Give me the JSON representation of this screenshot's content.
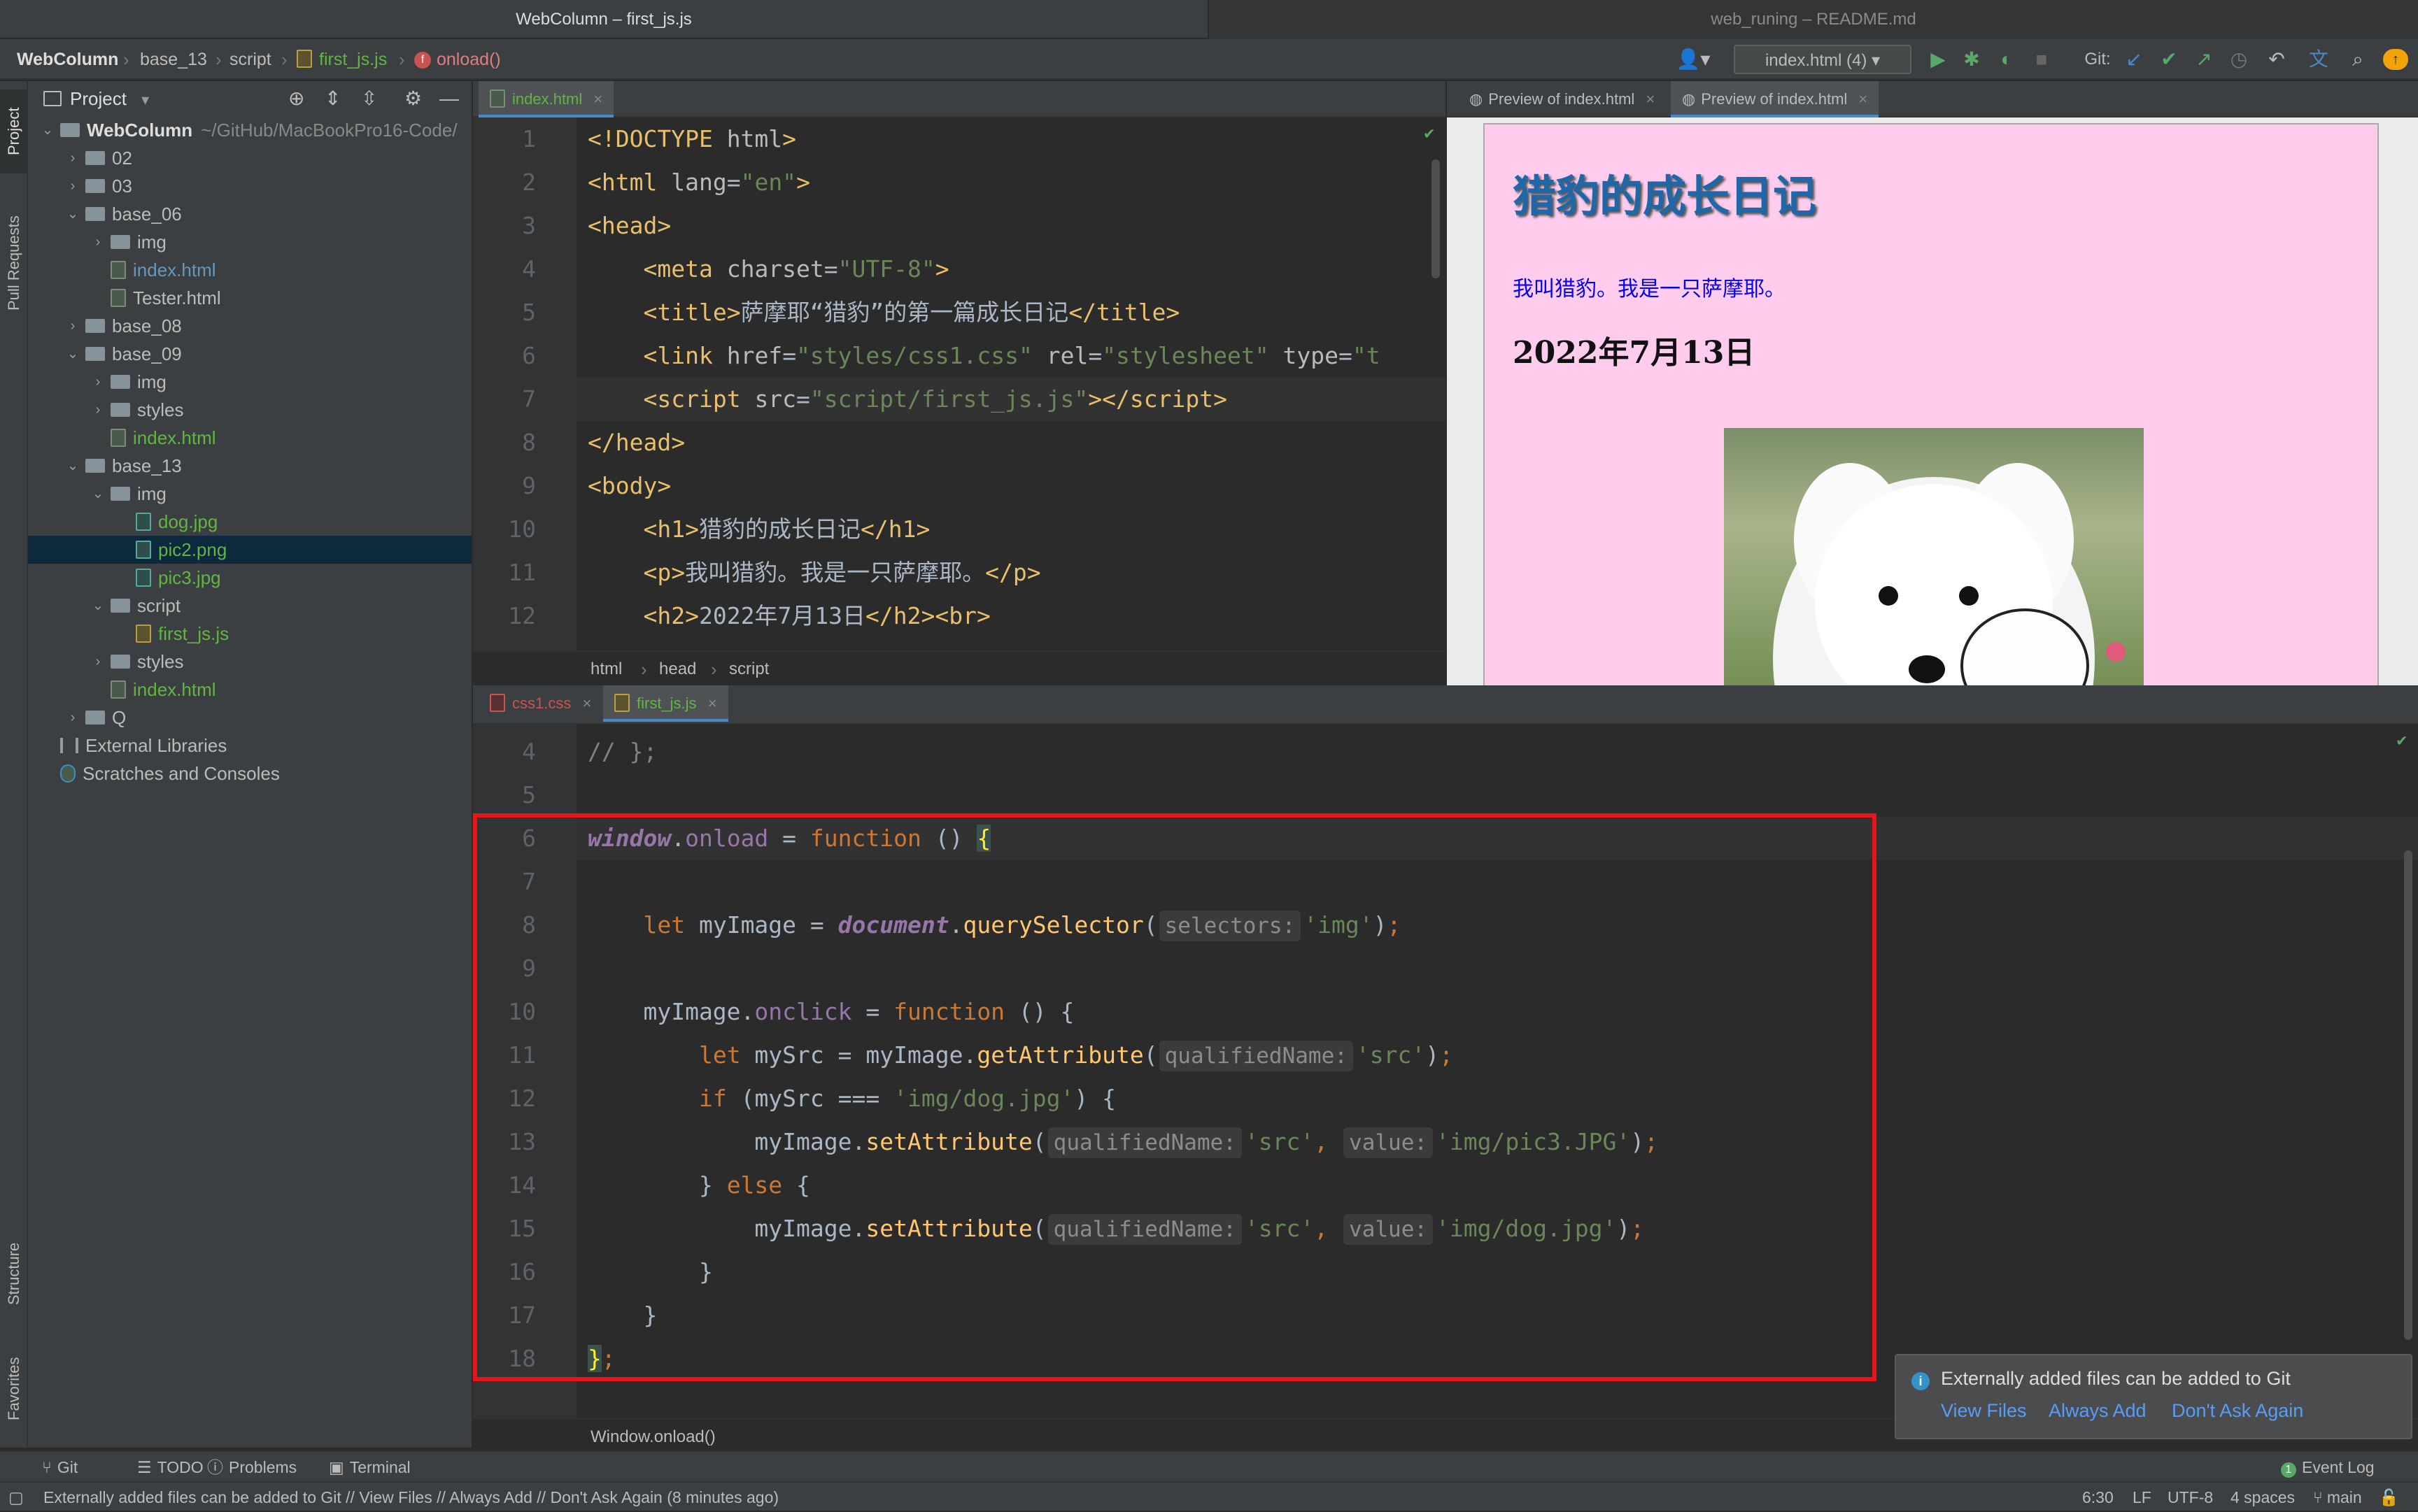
{
  "window": {
    "left_title": "WebColumn – first_js.js",
    "right_title": "web_runing – README.md"
  },
  "navbar": {
    "crumbs": [
      "WebColumn",
      "base_13",
      "script",
      "first_js.js",
      "onload()"
    ],
    "run_config": "index.html (4)",
    "git_label": "Git:"
  },
  "left_strip": {
    "project": "Project",
    "pull_requests": "Pull Requests",
    "structure": "Structure",
    "favorites": "Favorites"
  },
  "project": {
    "header": "Project",
    "tree": [
      {
        "label": "WebColumn",
        "suffix": "~/GitHub/MacBookPro16-Code/",
        "kind": "root",
        "indent": 0,
        "arrow": "open",
        "color": "#dddddd"
      },
      {
        "label": "02",
        "kind": "folder",
        "indent": 1,
        "arrow": "closed",
        "color": "#bbbbbb"
      },
      {
        "label": "03",
        "kind": "folder",
        "indent": 1,
        "arrow": "closed",
        "color": "#bbbbbb"
      },
      {
        "label": "base_06",
        "kind": "folder",
        "indent": 1,
        "arrow": "open",
        "color": "#bbbbbb"
      },
      {
        "label": "img",
        "kind": "folder",
        "indent": 2,
        "arrow": "closed",
        "color": "#bbbbbb"
      },
      {
        "label": "index.html",
        "kind": "html",
        "indent": 2,
        "arrow": "",
        "color": "#6897bb"
      },
      {
        "label": "Tester.html",
        "kind": "html",
        "indent": 2,
        "arrow": "",
        "color": "#bbbbbb"
      },
      {
        "label": "base_08",
        "kind": "folder",
        "indent": 1,
        "arrow": "closed",
        "color": "#bbbbbb"
      },
      {
        "label": "base_09",
        "kind": "folder",
        "indent": 1,
        "arrow": "open",
        "color": "#bbbbbb"
      },
      {
        "label": "img",
        "kind": "folder",
        "indent": 2,
        "arrow": "closed",
        "color": "#bbbbbb"
      },
      {
        "label": "styles",
        "kind": "folder",
        "indent": 2,
        "arrow": "closed",
        "color": "#bbbbbb"
      },
      {
        "label": "index.html",
        "kind": "html",
        "indent": 2,
        "arrow": "",
        "color": "#62b543"
      },
      {
        "label": "base_13",
        "kind": "folder",
        "indent": 1,
        "arrow": "open",
        "color": "#bbbbbb"
      },
      {
        "label": "img",
        "kind": "folder",
        "indent": 2,
        "arrow": "open",
        "color": "#bbbbbb"
      },
      {
        "label": "dog.jpg",
        "kind": "img",
        "indent": 3,
        "arrow": "",
        "color": "#62b543"
      },
      {
        "label": "pic2.png",
        "kind": "img",
        "indent": 3,
        "arrow": "",
        "color": "#62b543",
        "selected": true
      },
      {
        "label": "pic3.jpg",
        "kind": "img",
        "indent": 3,
        "arrow": "",
        "color": "#62b543"
      },
      {
        "label": "script",
        "kind": "folder",
        "indent": 2,
        "arrow": "open",
        "color": "#bbbbbb"
      },
      {
        "label": "first_js.js",
        "kind": "js",
        "indent": 3,
        "arrow": "",
        "color": "#62b543"
      },
      {
        "label": "styles",
        "kind": "folder",
        "indent": 2,
        "arrow": "closed",
        "color": "#bbbbbb"
      },
      {
        "label": "index.html",
        "kind": "html",
        "indent": 2,
        "arrow": "",
        "color": "#62b543"
      },
      {
        "label": "Q",
        "kind": "folder",
        "indent": 1,
        "arrow": "closed",
        "color": "#bbbbbb"
      },
      {
        "label": "External Libraries",
        "kind": "lib",
        "indent": 0,
        "arrow": "",
        "color": "#bbbbbb"
      },
      {
        "label": "Scratches and Consoles",
        "kind": "scratch",
        "indent": 0,
        "arrow": "",
        "color": "#bbbbbb"
      }
    ]
  },
  "editor_top": {
    "tab": "index.html",
    "lines": [
      {
        "n": "1",
        "html": "<span class=\"tag\">&lt;!DOCTYPE </span><span class=\"attr\">html</span><span class=\"tag\">&gt;</span>"
      },
      {
        "n": "2",
        "html": "<span class=\"tag\">&lt;html </span><span class=\"attr\">lang</span>=<span class=\"str\">\"en\"</span><span class=\"tag\">&gt;</span>"
      },
      {
        "n": "3",
        "html": "<span class=\"tag\">&lt;head&gt;</span>"
      },
      {
        "n": "4",
        "html": "    <span class=\"tag\">&lt;meta </span><span class=\"attr\">charset</span>=<span class=\"str\">\"UTF-8\"</span><span class=\"tag\">&gt;</span>"
      },
      {
        "n": "5",
        "html": "    <span class=\"tag\">&lt;title&gt;</span>萨摩耶“猎豹”的第一篇成长日记<span class=\"tag\">&lt;/title&gt;</span>"
      },
      {
        "n": "6",
        "html": "    <span class=\"tag\">&lt;link </span><span class=\"attr\">href</span>=<span class=\"str\">\"styles/css1.css\"</span> <span class=\"attr\">rel</span>=<span class=\"str\">\"stylesheet\"</span> <span class=\"attr\">type</span>=<span class=\"str\">\"t</span>"
      },
      {
        "n": "7",
        "html": "    <span class=\"tag\">&lt;script </span><span class=\"attr\">src</span>=<span class=\"str\">\"script/first_js.js\"</span><span class=\"tag\">&gt;&lt;/script&gt;</span>"
      },
      {
        "n": "8",
        "html": "<span class=\"tag\">&lt;/head&gt;</span>"
      },
      {
        "n": "9",
        "html": "<span class=\"tag\">&lt;body&gt;</span>"
      },
      {
        "n": "10",
        "html": "    <span class=\"tag\">&lt;h1&gt;</span>猎豹的成长日记<span class=\"tag\">&lt;/h1&gt;</span>"
      },
      {
        "n": "11",
        "html": "    <span class=\"tag\">&lt;p&gt;</span>我叫猎豹。我是一只萨摩耶。<span class=\"tag\">&lt;/p&gt;</span>"
      },
      {
        "n": "12",
        "html": "    <span class=\"tag\">&lt;h2&gt;</span>2022年7月13日<span class=\"tag\">&lt;/h2&gt;&lt;br&gt;</span>"
      }
    ],
    "breadcrumb": [
      "html",
      "head",
      "script"
    ]
  },
  "preview": {
    "tabs": [
      "Preview of index.html",
      "Preview of index.html"
    ],
    "h1": "猎豹的成长日记",
    "p": "我叫猎豹。我是一只萨摩耶。",
    "h2": "2022年7月13日"
  },
  "editor_bottom": {
    "tabs": [
      "css1.css",
      "first_js.js"
    ],
    "lines": [
      {
        "n": "4",
        "html": "<span class=\"cmt\">// };</span>"
      },
      {
        "n": "5",
        "html": ""
      },
      {
        "n": "6",
        "html": "<span class=\"glob\">window</span>.<span class=\"prop\">onload</span> = <span class=\"kw\">function</span> () <span style=\"color:#ffef28;background:#3b514d\">{</span>"
      },
      {
        "n": "7",
        "html": ""
      },
      {
        "n": "8",
        "html": "    <span class=\"kw\">let</span> myImage = <span class=\"glob\">document</span>.<span class=\"fn\">querySelector</span>(<span class=\"hint\">selectors:</span><span class=\"str\">'img'</span>)<span class=\"kw\">;</span>"
      },
      {
        "n": "9",
        "html": ""
      },
      {
        "n": "10",
        "html": "    myImage.<span class=\"prop\">onclick</span> = <span class=\"kw\">function</span> () {"
      },
      {
        "n": "11",
        "html": "        <span class=\"kw\">let</span> mySrc = myImage.<span class=\"fn\">getAttribute</span>(<span class=\"hint\">qualifiedName:</span><span class=\"str\">'src'</span>)<span class=\"kw\">;</span>"
      },
      {
        "n": "12",
        "html": "        <span class=\"kw\">if</span> (mySrc === <span class=\"str\">'img/dog.jpg'</span>) {"
      },
      {
        "n": "13",
        "html": "            myImage.<span class=\"fn\">setAttribute</span>(<span class=\"hint\">qualifiedName:</span><span class=\"str\">'src'</span><span class=\"kw\">,</span> <span class=\"hint\">value:</span><span class=\"str\">'img/pic3.JPG'</span>)<span class=\"kw\">;</span>"
      },
      {
        "n": "14",
        "html": "        } <span class=\"kw\">else</span> {"
      },
      {
        "n": "15",
        "html": "            myImage.<span class=\"fn\">setAttribute</span>(<span class=\"hint\">qualifiedName:</span><span class=\"str\">'src'</span><span class=\"kw\">,</span> <span class=\"hint\">value:</span><span class=\"str\">'img/dog.jpg'</span>)<span class=\"kw\">;</span>"
      },
      {
        "n": "16",
        "html": "        }"
      },
      {
        "n": "17",
        "html": "    }"
      },
      {
        "n": "18",
        "html": "<span style=\"color:#ffef28;background:#3b514d\">}</span><span class=\"kw\">;</span>"
      }
    ],
    "breadcrumb": "Window.onload()"
  },
  "notification": {
    "message": "Externally added files can be added to Git",
    "actions": [
      "View Files",
      "Always Add",
      "Don't Ask Again"
    ]
  },
  "bottom_tabs": [
    "Git",
    "TODO",
    "Problems",
    "Terminal"
  ],
  "event_log": "Event Log",
  "status": {
    "message": "Externally added files can be added to Git // View Files // Always Add // Don't Ask Again (8 minutes ago)",
    "position": "6:30",
    "line_sep": "LF",
    "encoding": "UTF-8",
    "indent": "4 spaces",
    "branch": "main"
  },
  "colors": {
    "accent": "#4a88c7",
    "highlight_box": "#e8141c",
    "preview_bg": "#ffccee"
  }
}
